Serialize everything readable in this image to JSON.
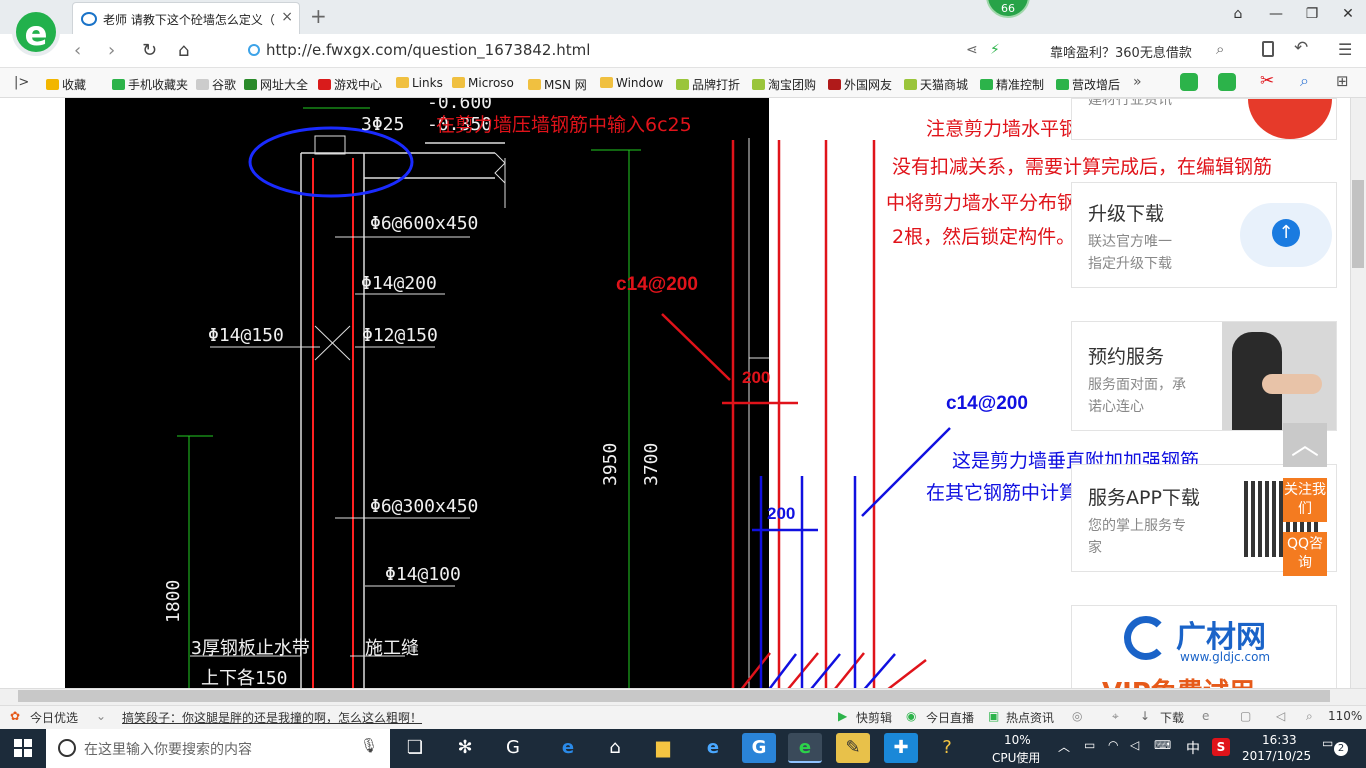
{
  "browser": {
    "tab_title": "老师 请教下这个砼墙怎么定义（",
    "tab_close": "×",
    "new_tab": "+",
    "badge": "66",
    "url": "http://e.fwxgx.com/question_1673842.html",
    "search_text": "靠啥盈利？360无息借款",
    "window_controls": [
      "⌂",
      "—",
      "❐",
      "✕"
    ],
    "bookmarks": [
      {
        "label": "收藏",
        "color": "#f2b600"
      },
      {
        "label": "手机收藏夹",
        "color": "#2cb34a"
      },
      {
        "label": "谷歌",
        "color": "#cccccc"
      },
      {
        "label": "网址大全",
        "color": "#2a8a2a"
      },
      {
        "label": "游戏中心",
        "color": "#d91b1b"
      },
      {
        "label": "Links",
        "color": "#f0c040"
      },
      {
        "label": "Microso",
        "color": "#f0c040"
      },
      {
        "label": "MSN 网",
        "color": "#f0c040"
      },
      {
        "label": "Window",
        "color": "#f0c040"
      },
      {
        "label": "品牌打折",
        "color": "#9ac53b"
      },
      {
        "label": "淘宝团购",
        "color": "#9ac53b"
      },
      {
        "label": "外国网友",
        "color": "#b01a1a"
      },
      {
        "label": "天猫商城",
        "color": "#9ac53b"
      },
      {
        "label": "精准控制",
        "color": "#2cb34a"
      },
      {
        "label": "营改增后",
        "color": "#2cb34a"
      }
    ],
    "more": "»"
  },
  "cad": {
    "labels": {
      "top_elev1": "-0.600",
      "top_elev2": "-0.350",
      "rebar_top": "3Φ25",
      "stirrup1": "Φ6@600x450",
      "vert1": "Φ14@200",
      "left1": "Φ14@150",
      "mid1": "Φ12@150",
      "stirrup2": "Φ6@300x450",
      "vert2": "Φ14@100",
      "dim_3950": "3950",
      "dim_3700": "3700",
      "dim_1800": "1800",
      "note1": "3厚钢板止水带",
      "note2": "上下各150",
      "joint": "施工缝"
    }
  },
  "annotations": {
    "red_top": "在剪力墙压墙钢筋中输入6c25",
    "red_note1": "注意剪力墙水平钢筋和压墙钢筋",
    "red_note2": "没有扣减关系，需要计算完成后，在编辑钢筋",
    "red_note3": "中将剪力墙水平分布钢筋的根数减去",
    "red_note4": "2根，然后锁定构件。",
    "red_c14": "c14@200",
    "red_200": "200",
    "blue_c14": "c14@200",
    "blue_note1": "这是剪力墙垂直附加加强钢筋",
    "blue_note2": "在其它钢筋中计算输入",
    "blue_200": "200"
  },
  "sidebar": {
    "card_top_partial": "建材行业资讯",
    "upgrade_title": "升级下载",
    "upgrade_sub1": "联达官方唯一",
    "upgrade_sub2": "指定升级下载",
    "service_title": "预约服务",
    "service_sub1": "服务面对面，承",
    "service_sub2": "诺心连心",
    "app_title": "服务APP下载",
    "app_sub1": "您的掌上服务专",
    "app_sub2": "家",
    "follow_btn": "关注我们",
    "qq_btn": "QQ咨询",
    "brand_name": "广材网",
    "brand_url": "www.gldjc.com",
    "brand_vip": "VIP免费试用"
  },
  "statusbar": {
    "left_label": "今日优选",
    "news": "搞笑段子：你这腿是胖的还是我撞的啊，怎么这么粗啊！",
    "kuaijianji": "快剪辑",
    "zhibo": "今日直播",
    "redian": "热点资讯",
    "xiazai": "下载",
    "zoom": "110%"
  },
  "taskbar": {
    "search_placeholder": "在这里输入你要搜索的内容",
    "cpu": "10%",
    "cpu_label": "CPU使用",
    "ime": "中",
    "time": "16:33",
    "date": "2017/10/25",
    "notif": "2"
  }
}
